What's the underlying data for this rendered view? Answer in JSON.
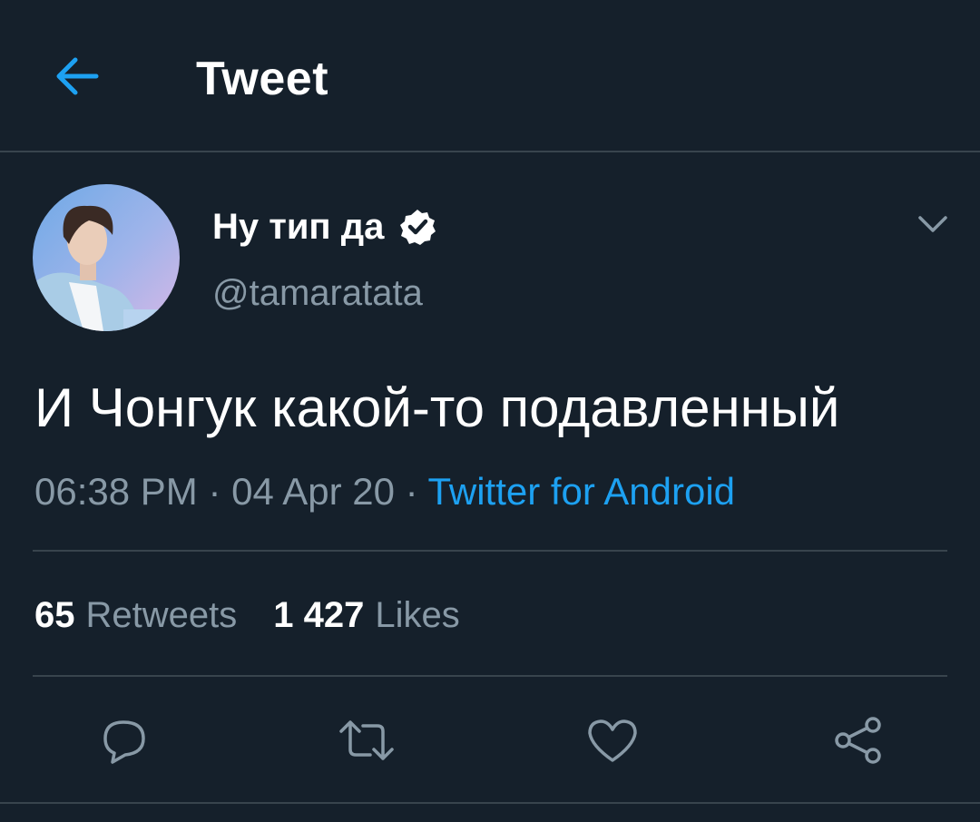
{
  "header": {
    "title": "Tweet",
    "back_icon": "arrow-left-icon"
  },
  "tweet": {
    "author_name": "Ну тип да",
    "verified": true,
    "handle": "@tamaratata",
    "text": "И Чонгук какой-то подавленный",
    "time": "06:38 PM",
    "date": "04 Apr 20",
    "separator": "·",
    "source": "Twitter for Android"
  },
  "stats": {
    "retweets_count": "65",
    "retweets_label": "Retweets",
    "likes_count": "1 427",
    "likes_label": "Likes"
  },
  "actions": [
    "reply-icon",
    "retweet-icon",
    "like-icon",
    "share-icon"
  ],
  "colors": {
    "background": "#15202b",
    "accent": "#1da1f2",
    "secondary_text": "#8899a6",
    "divider": "#38444d"
  }
}
